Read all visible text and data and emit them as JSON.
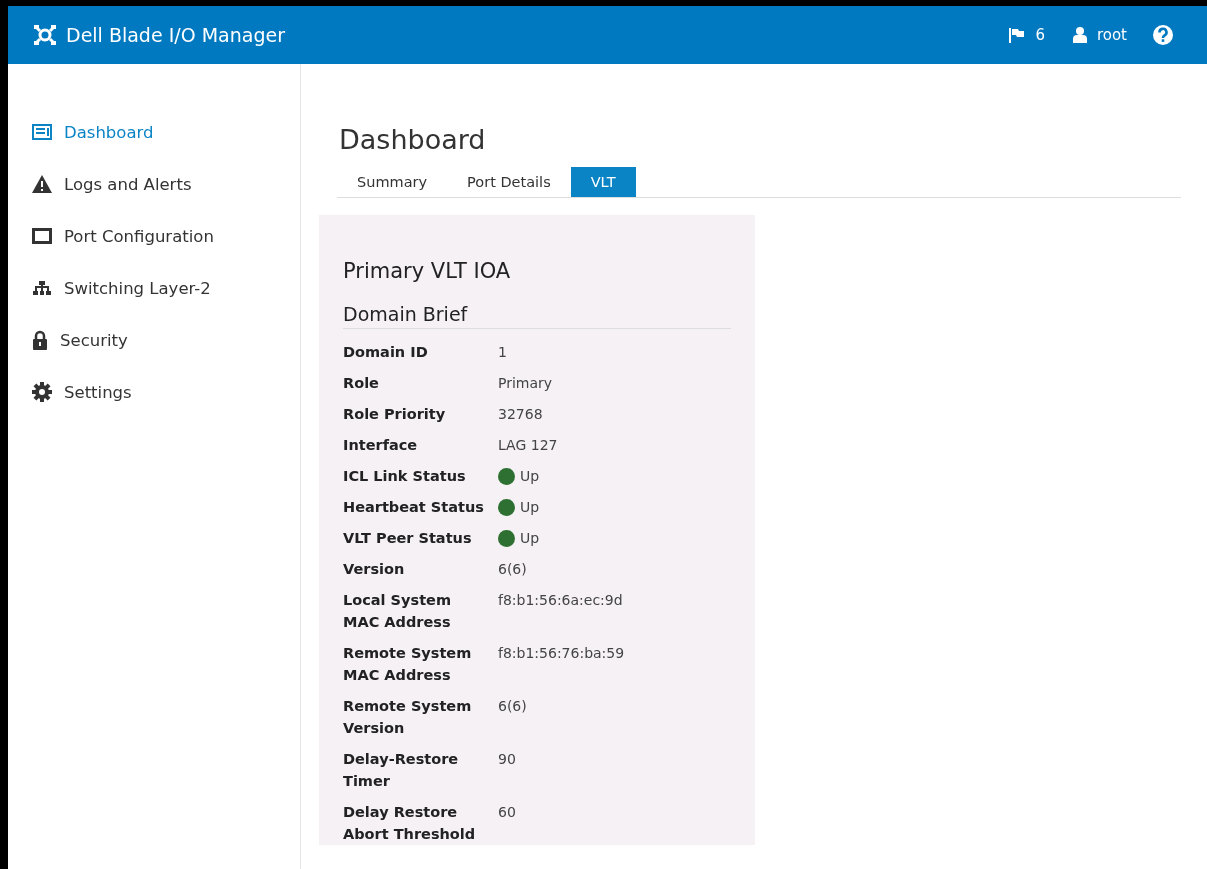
{
  "header": {
    "title": "Dell Blade I/O Manager",
    "alerts_count": "6",
    "user": "root"
  },
  "sidebar": {
    "items": [
      {
        "label": "Dashboard",
        "kind": "dashboard",
        "selected": true
      },
      {
        "label": "Logs and Alerts",
        "kind": "warning",
        "selected": false
      },
      {
        "label": "Port Configuration",
        "kind": "port",
        "selected": false
      },
      {
        "label": "Switching Layer-2",
        "kind": "network",
        "selected": false
      },
      {
        "label": "Security",
        "kind": "lock",
        "selected": false
      },
      {
        "label": "Settings",
        "kind": "gear",
        "selected": false
      }
    ]
  },
  "page": {
    "title": "Dashboard",
    "tabs": [
      {
        "label": "Summary",
        "selected": false
      },
      {
        "label": "Port Details",
        "selected": false
      },
      {
        "label": "VLT",
        "selected": true
      }
    ],
    "panel": {
      "title": "Primary VLT IOA",
      "section": "Domain Brief",
      "rows": [
        {
          "label": "Domain ID",
          "value": "1",
          "kind": "text"
        },
        {
          "label": "Role",
          "value": "Primary",
          "kind": "text"
        },
        {
          "label": "Role Priority",
          "value": "32768",
          "kind": "text"
        },
        {
          "label": "Interface",
          "value": "LAG 127",
          "kind": "text"
        },
        {
          "label": "ICL Link Status",
          "value": "Up",
          "kind": "status",
          "color": "#2e7031"
        },
        {
          "label": "Heartbeat Status",
          "value": "Up",
          "kind": "status",
          "color": "#2e7031"
        },
        {
          "label": "VLT Peer Status",
          "value": "Up",
          "kind": "status",
          "color": "#2e7031"
        },
        {
          "label": "Version",
          "value": "6(6)",
          "kind": "text"
        },
        {
          "label": "Local System\nMAC Address",
          "value": "f8:b1:56:6a:ec:9d",
          "kind": "text"
        },
        {
          "label": "Remote System\nMAC Address",
          "value": "f8:b1:56:76:ba:59",
          "kind": "text"
        },
        {
          "label": "Remote System\nVersion",
          "value": "6(6)",
          "kind": "text"
        },
        {
          "label": "Delay-Restore\nTimer",
          "value": "90",
          "kind": "text"
        },
        {
          "label": "Delay Restore\nAbort Threshold",
          "value": "60",
          "kind": "text"
        }
      ]
    }
  }
}
